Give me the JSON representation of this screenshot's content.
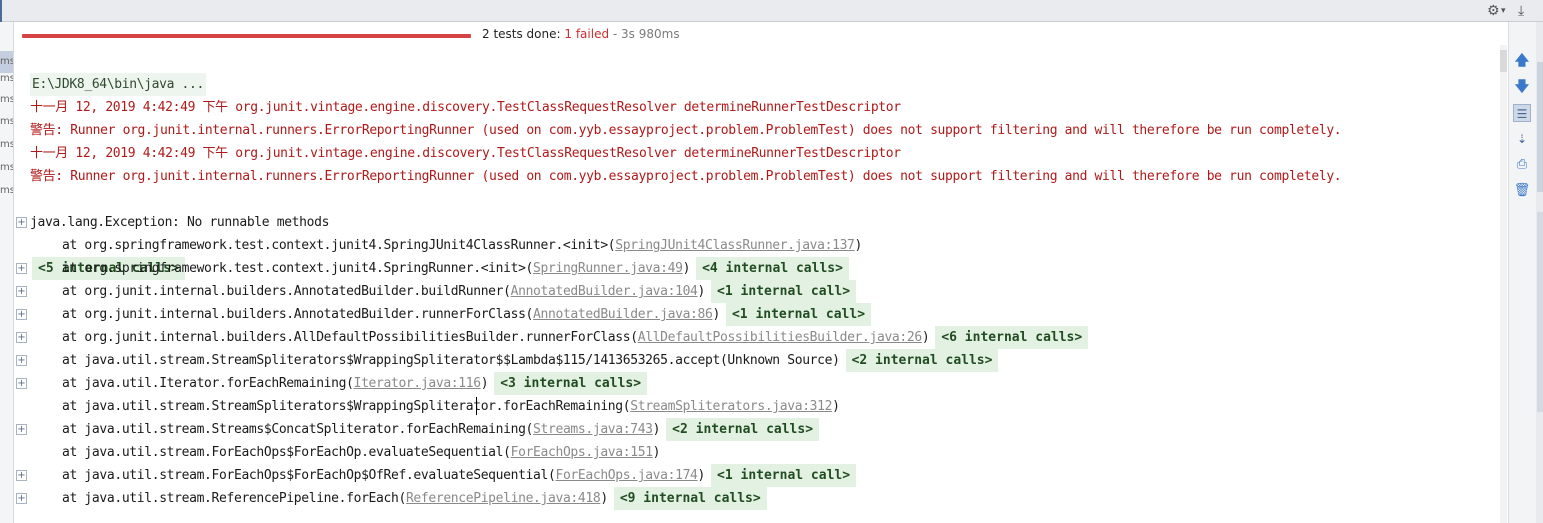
{
  "toolbar": {
    "settings_icon": "gear-icon",
    "hide_icon": "hide-icon"
  },
  "left_strip": {
    "items": [
      "ms",
      "ms",
      "ms",
      "ms",
      "ms",
      "ms",
      "ms"
    ]
  },
  "status": {
    "progress_fraction": 1.0,
    "progress_color": "#d64343",
    "summary_prefix": "2 tests done: ",
    "failed": "1 failed",
    "duration": " - 3s 980ms"
  },
  "console": {
    "command": "E:\\JDK8_64\\bin\\java ...",
    "log_lines": [
      "十一月 12, 2019 4:42:49 下午 org.junit.vintage.engine.discovery.TestClassRequestResolver determineRunnerTestDescriptor",
      "警告: Runner org.junit.internal.runners.ErrorReportingRunner (used on com.yyb.essayproject.problem.ProblemTest) does not support filtering and will therefore be run completely.",
      "十一月 12, 2019 4:42:49 下午 org.junit.vintage.engine.discovery.TestClassRequestResolver determineRunnerTestDescriptor",
      "警告: Runner org.junit.internal.runners.ErrorReportingRunner (used on com.yyb.essayproject.problem.ProblemTest) does not support filtering and will therefore be run completely."
    ],
    "exception": "java.lang.Exception: No runnable methods",
    "first_fold": "<5 internal calls>",
    "frames": [
      {
        "prefix": "at org.springframework.test.context.junit4.SpringJUnit4ClassRunner.<init>(",
        "link": "SpringJUnit4ClassRunner.java:137",
        "suffix": ")",
        "fold": ""
      },
      {
        "prefix": "at org.springframework.test.context.junit4.SpringRunner.<init>(",
        "link": "SpringRunner.java:49",
        "suffix": ")",
        "fold": "<4 internal calls>"
      },
      {
        "prefix": "at org.junit.internal.builders.AnnotatedBuilder.buildRunner(",
        "link": "AnnotatedBuilder.java:104",
        "suffix": ")",
        "fold": "<1 internal call>"
      },
      {
        "prefix": "at org.junit.internal.builders.AnnotatedBuilder.runnerForClass(",
        "link": "AnnotatedBuilder.java:86",
        "suffix": ")",
        "fold": "<1 internal call>"
      },
      {
        "prefix": "at org.junit.internal.builders.AllDefaultPossibilitiesBuilder.runnerForClass(",
        "link": "AllDefaultPossibilitiesBuilder.java:26",
        "suffix": ")",
        "fold": "<6 internal calls>"
      },
      {
        "prefix": "at java.util.stream.StreamSpliterators$WrappingSpliterator$$Lambda$115/1413653265.accept(Unknown Source)",
        "link": "",
        "suffix": "",
        "fold": "<2 internal calls>"
      },
      {
        "prefix": "at java.util.Iterator.forEachRemaining(",
        "link": "Iterator.java:116",
        "suffix": ")",
        "fold": "<3 internal calls>"
      },
      {
        "prefix": "at java.util.stream.StreamSpliterators$WrappingSpliterator.forEachRemaining(",
        "link": "StreamSpliterators.java:312",
        "suffix": ")",
        "fold": ""
      },
      {
        "prefix": "at java.util.stream.Streams$ConcatSpliterator.forEachRemaining(",
        "link": "Streams.java:743",
        "suffix": ")",
        "fold": "<2 internal calls>"
      },
      {
        "prefix": "at java.util.stream.ForEachOps$ForEachOp.evaluateSequential(",
        "link": "ForEachOps.java:151",
        "suffix": ")",
        "fold": ""
      },
      {
        "prefix": "at java.util.stream.ForEachOps$ForEachOp$OfRef.evaluateSequential(",
        "link": "ForEachOps.java:174",
        "suffix": ")",
        "fold": "<1 internal call>"
      },
      {
        "prefix": "at java.util.stream.ReferencePipeline.forEach(",
        "link": "ReferencePipeline.java:418",
        "suffix": ")",
        "fold": "<9 internal calls>"
      }
    ]
  },
  "right_toolbar": {
    "icons": [
      "arrow-up-icon",
      "arrow-down-icon",
      "soft-wrap-icon",
      "scroll-to-end-icon",
      "print-icon",
      "trash-icon"
    ]
  }
}
